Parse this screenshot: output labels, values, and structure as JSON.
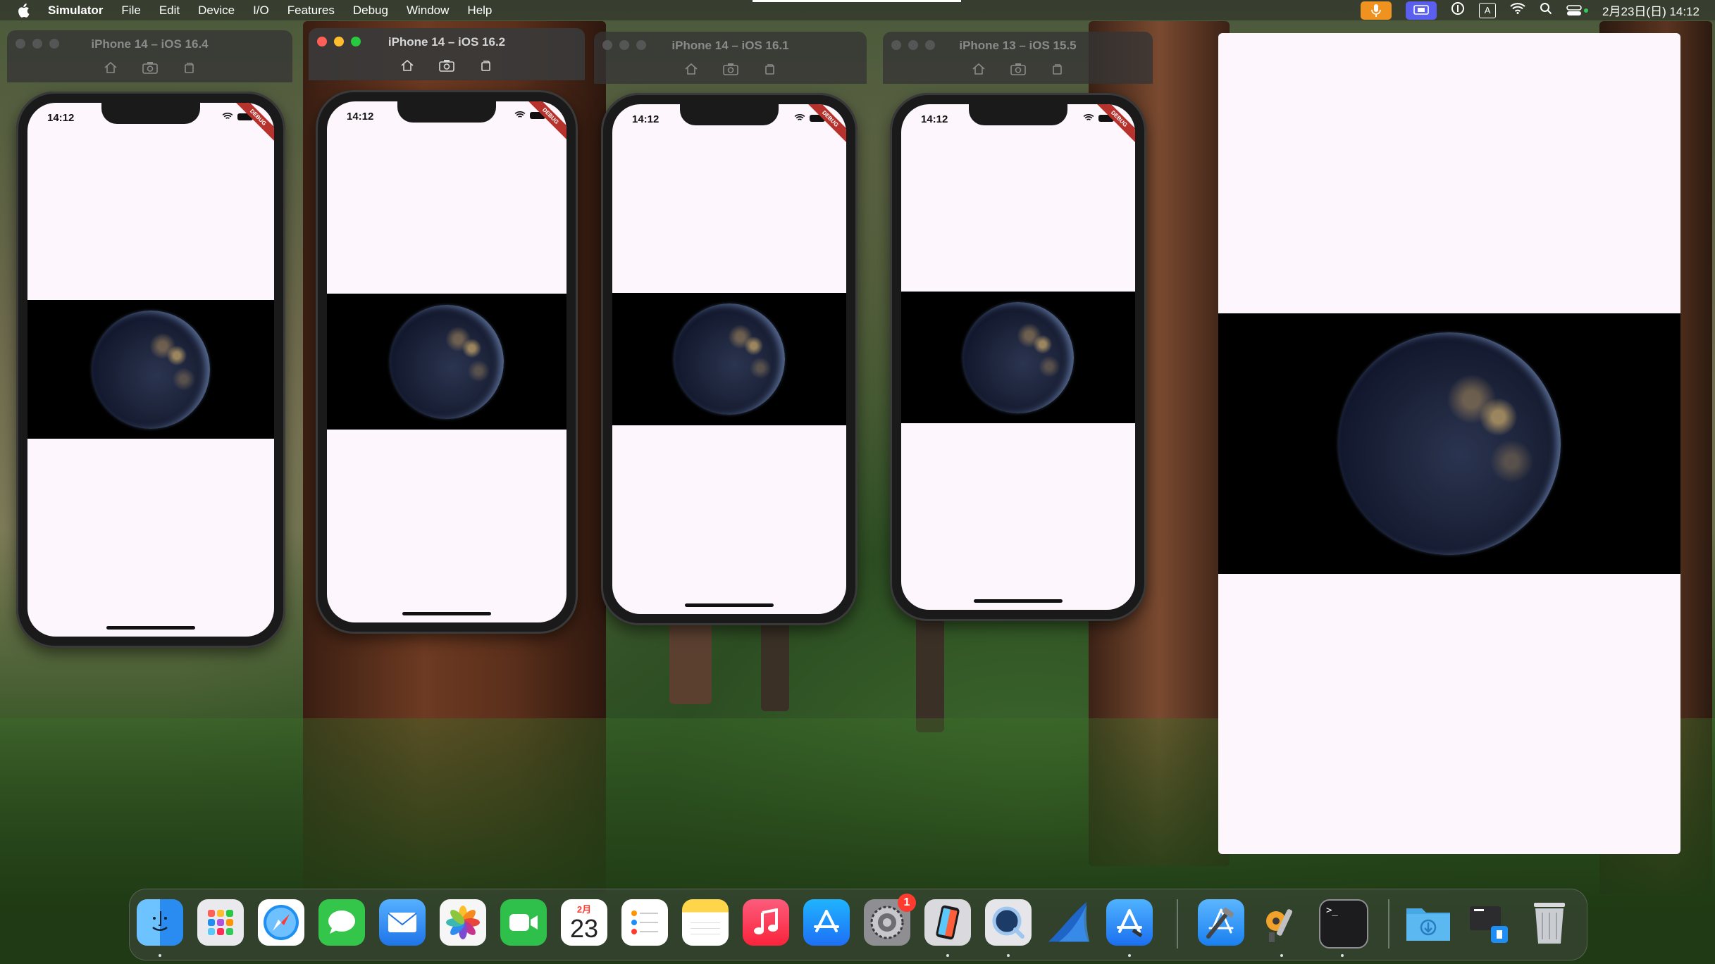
{
  "menubar": {
    "app_name": "Simulator",
    "items": [
      "File",
      "Edit",
      "Device",
      "I/O",
      "Features",
      "Debug",
      "Window",
      "Help"
    ],
    "clock": "2月23日(日)  14:12",
    "status_icons": [
      "microphone-icon",
      "screen-share-icon",
      "one-password-icon",
      "input-method-icon",
      "wifi-icon",
      "search-icon",
      "control-center-icon"
    ],
    "input_method_label": "A"
  },
  "simulators": [
    {
      "title": "iPhone 14 – iOS 16.4",
      "time": "14:12",
      "active": false
    },
    {
      "title": "iPhone 14 – iOS 16.2",
      "time": "14:12",
      "active": true
    },
    {
      "title": "iPhone 14 – iOS 16.1",
      "time": "14:12",
      "active": false
    },
    {
      "title": "iPhone 13 – iOS 15.5",
      "time": "14:12",
      "active": false
    }
  ],
  "debug_ribbon": "DEBUG",
  "dock": {
    "icons": [
      {
        "name": "finder-icon",
        "color": "#2a8cf0"
      },
      {
        "name": "launchpad-icon",
        "color": "#e9e9ee"
      },
      {
        "name": "safari-icon",
        "color": "#1f8ff2"
      },
      {
        "name": "messages-icon",
        "color": "#33c64a"
      },
      {
        "name": "mail-icon",
        "color": "#2b86f3"
      },
      {
        "name": "photos-icon",
        "color": "#f6f6f6"
      },
      {
        "name": "facetime-icon",
        "color": "#2ec04a"
      },
      {
        "name": "calendar-icon",
        "color": "#ffffff"
      },
      {
        "name": "reminders-icon",
        "color": "#ffffff"
      },
      {
        "name": "notes-icon",
        "color": "#ffd54a"
      },
      {
        "name": "music-icon",
        "color": "#fa3c52"
      },
      {
        "name": "app-store-icon",
        "color": "#1e8ef5"
      },
      {
        "name": "system-settings-icon",
        "color": "#8e8e93"
      },
      {
        "name": "simulator-icon",
        "color": "#d9d9de"
      },
      {
        "name": "quicktime-icon",
        "color": "#1c3b66"
      },
      {
        "name": "sharkfin-icon",
        "color": "#1f64c7"
      },
      {
        "name": "xcode-instruments-icon",
        "color": "#1b7ff0"
      },
      {
        "name": "xcode-icon",
        "color": "#1a80f0"
      },
      {
        "name": "keychain-icon",
        "color": "#3a3a3a"
      },
      {
        "name": "terminal-icon",
        "color": "#1c1c1e"
      },
      {
        "name": "downloads-folder-icon",
        "color": "#48a8e6"
      },
      {
        "name": "window-stack-icon",
        "color": "#2c2c2e"
      },
      {
        "name": "trash-icon",
        "color": "#c9ccd1"
      }
    ],
    "calendar_month": "2月",
    "calendar_day": "23",
    "settings_badge": "1",
    "terminal_prompt": ">_"
  }
}
